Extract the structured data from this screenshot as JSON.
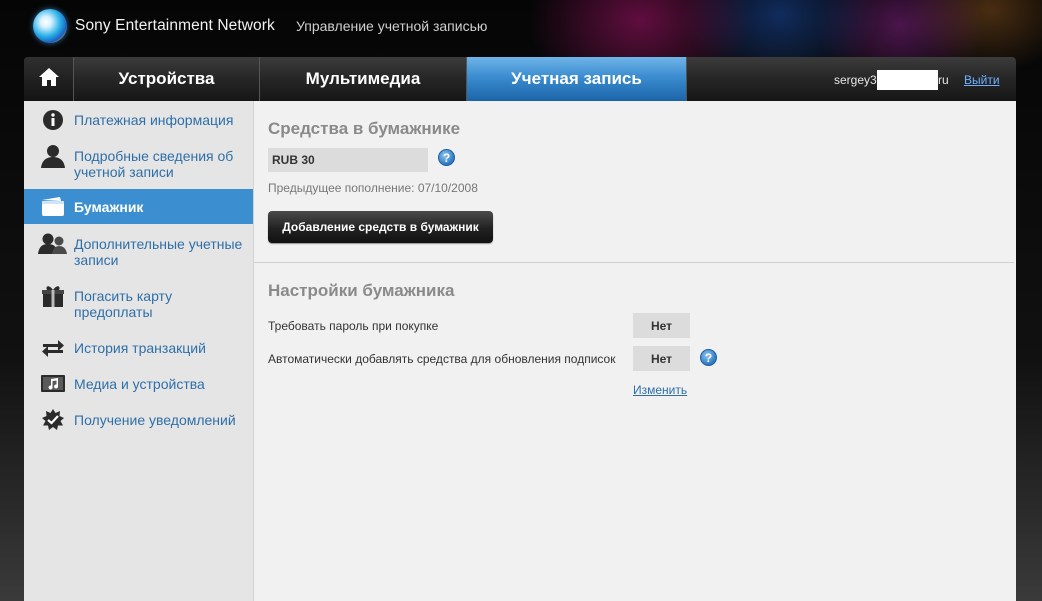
{
  "header": {
    "brand": "Sony Entertainment Network",
    "subtitle": "Управление учетной записью"
  },
  "nav": {
    "tabs": [
      {
        "label": "Устройства",
        "active": false
      },
      {
        "label": "Мультимедиа",
        "active": false
      },
      {
        "label": "Учетная запись",
        "active": true
      }
    ],
    "user_visible_prefix": "sergey3",
    "user_visible_suffix": "ru",
    "logout_label": "Выйти"
  },
  "sidebar": {
    "items": [
      {
        "label": "Платежная информация",
        "icon": "info-icon",
        "active": false
      },
      {
        "label": "Подробные сведения об учетной записи",
        "icon": "user-icon",
        "active": false
      },
      {
        "label": "Бумажник",
        "icon": "wallet-icon",
        "active": true
      },
      {
        "label": "Дополнительные учетные записи",
        "icon": "users-icon",
        "active": false
      },
      {
        "label": "Погасить карту предоплаты",
        "icon": "gift-icon",
        "active": false
      },
      {
        "label": "История транзакций",
        "icon": "transfer-arrows-icon",
        "active": false
      },
      {
        "label": "Медиа и устройства",
        "icon": "media-note-icon",
        "active": false
      },
      {
        "label": "Получение уведомлений",
        "icon": "notification-badge-icon",
        "active": false
      }
    ]
  },
  "wallet": {
    "title": "Средства в бумажнике",
    "balance": "RUB 30",
    "previous_topup": "Предыдущее пополнение: 07/10/2008",
    "add_funds_button": "Добавление средств в бумажник"
  },
  "settings": {
    "title": "Настройки бумажника",
    "rows": [
      {
        "label": "Требовать пароль при покупке",
        "value": "Нет"
      },
      {
        "label": "Автоматически добавлять средства для обновления подписок",
        "value": "Нет"
      }
    ],
    "edit_link": "Изменить"
  },
  "colors": {
    "accent_blue": "#3b8fd1",
    "link_blue": "#2f6fa8",
    "panel_bg": "#f1f1f1",
    "sidebar_bg": "#e5e5e5"
  }
}
